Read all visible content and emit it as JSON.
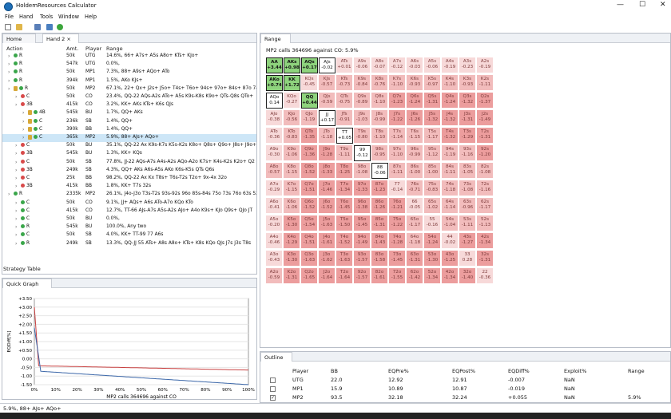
{
  "window": {
    "title": "HoldemResources Calculator"
  },
  "menu": [
    "File",
    "Hand",
    "Tools",
    "Window",
    "Help"
  ],
  "left_tabs": [
    "Home",
    "Hand 2"
  ],
  "columns": [
    "Action",
    "Amt.",
    "Player",
    "Range"
  ],
  "rows": [
    {
      "action": "R",
      "amt": "50k",
      "player": "UTG",
      "range": "14.6%, 66+ A7s+ A5s A8o+ KTs+ KJo+"
    },
    {
      "action": "R",
      "amt": "547k",
      "player": "UTG",
      "range": "0.0%,"
    },
    {
      "action": "R",
      "amt": "50k",
      "player": "MP1",
      "range": "7.3%, 88+ A9s+ AQo+ ATo"
    },
    {
      "action": "R",
      "amt": "394k",
      "player": "MP1",
      "range": "1.5%, AKo KJs+"
    },
    {
      "action": "R",
      "amt": "50k",
      "player": "MP2",
      "range": "67.1%, 22+ Qx+ J2s+ J5o+ T4s+ T6o+ 94s+ 97o+ 84s+ 87o 74s+"
    },
    {
      "action": "C",
      "amt": "50k",
      "player": "CO",
      "range": "23.4%, QQ-22 AQs-A2s ATo+ A5s K9s-K8s K9o+ QTs-Q8s QTo+"
    },
    {
      "action": "3B",
      "amt": "415k",
      "player": "CO",
      "range": "3.2%, KK+ AKs KTs+ K6s QJs"
    },
    {
      "action": "4B",
      "amt": "545k",
      "player": "BU",
      "range": "1.7%, QQ+ AKs"
    },
    {
      "action": "C",
      "amt": "236k",
      "player": "SB",
      "range": "1.4%, QQ+"
    },
    {
      "action": "C",
      "amt": "390k",
      "player": "BB",
      "range": "1.4%, QQ+"
    },
    {
      "action": "C",
      "amt": "365k",
      "player": "MP2",
      "range": "5.9%, 88+ AJs+ AQo+"
    },
    {
      "action": "C",
      "amt": "50k",
      "player": "BU",
      "range": "35.1%, QQ-22 Ax K9s-K7s K5s-K2s K8o+ Q8s+ Q9o+ J8s+ J9o+ T"
    },
    {
      "action": "3B",
      "amt": "545k",
      "player": "BU",
      "range": "1.3%, KK+ KQs"
    },
    {
      "action": "C",
      "amt": "50k",
      "player": "SB",
      "range": "77.8%, JJ-22 AQs-A7s A4s-A2s AQo-A2o K7s+ K4s-K2s K2o+ Q2"
    },
    {
      "action": "3B",
      "amt": "249k",
      "player": "SB",
      "range": "4.3%, QQ+ AKs A6s-A5s AKo K6s-K5s QTs Q6s"
    },
    {
      "action": "C",
      "amt": "25k",
      "player": "BB",
      "range": "98.2%, QQ-22 Ax Kx T8s+ T6s-T2s T2o+ 9x-4x 32o"
    },
    {
      "action": "3B",
      "amt": "415k",
      "player": "BB",
      "range": "1.8%, KK+ T7s 32s"
    },
    {
      "action": "R",
      "amt": "2335k",
      "player": "MP2",
      "range": "26.1%, J4o-J3o T3s-T2s 93s-92s 96o 85s-84s 75o 73s 76o 63s 52s 54o 4"
    },
    {
      "action": "C",
      "amt": "50k",
      "player": "CO",
      "range": "9.1%, JJ+ AQs+ A6s ATo-A7o KQo KTo"
    },
    {
      "action": "C",
      "amt": "415k",
      "player": "CO",
      "range": "12.7%, TT-66 AJs-A7s A5s-A2s AJo+ A4o K9s+ KJo Q9s+ QJo JT"
    },
    {
      "action": "C",
      "amt": "50k",
      "player": "BU",
      "range": "0.0%,"
    },
    {
      "action": "R",
      "amt": "545k",
      "player": "BU",
      "range": "100.0%, Any two"
    },
    {
      "action": "C",
      "amt": "50k",
      "player": "SB",
      "range": "4.0%, KK+ TT-99 77 A6s"
    },
    {
      "action": "R",
      "amt": "249k",
      "player": "SB",
      "range": "13.3%, QQ-JJ 55 ATs+ A8s A8o+ KTs+ K8s KQo QJs J7s J3s T8s"
    }
  ],
  "strategy_table": "Strategy Table",
  "quick_graph": {
    "tab": "Quick Graph",
    "ylabel": "EQDiff[%]",
    "yticks": [
      "+3.50",
      "+3.00",
      "+2.50",
      "+2.00",
      "+1.50",
      "+1.00",
      "+0.50",
      "0.00",
      "-0.50",
      "-1.00",
      "-1.50"
    ],
    "xticks": [
      "0%",
      "10%",
      "20%",
      "30%",
      "40%",
      "50%",
      "60%",
      "70%",
      "80%",
      "90%",
      "100%"
    ],
    "caption": "MP2 calls 364696 against CO"
  },
  "range_panel": {
    "tab": "Range",
    "subtitle": "MP2 calls 364696 against CO: 5.9%",
    "ranks": [
      "A",
      "K",
      "Q",
      "J",
      "T",
      "9",
      "8",
      "7",
      "6",
      "5",
      "4",
      "3",
      "2"
    ],
    "cells": [
      [
        "+3.44",
        "+0.98",
        "+0.17",
        "-0.02",
        "+0.01",
        "-0.06",
        "-0.07",
        "-0.12",
        "-0.03",
        "-0.06",
        "-0.19",
        "-0.23",
        "-0.19"
      ],
      [
        "+0.74",
        "+1.72",
        "-0.45",
        "-0.57",
        "-0.73",
        "-0.84",
        "-0.76",
        "-1.10",
        "-0.93",
        "-0.97",
        "-1.10",
        "-0.93",
        "-1.11"
      ],
      [
        "0.14",
        "-0.27",
        "+0.44",
        "-0.59",
        "-0.75",
        "-0.89",
        "-1.10",
        "-1.23",
        "-1.24",
        "-1.31",
        "-1.24",
        "-1.32",
        "-1.37"
      ],
      [
        "-0.38",
        "-0.56",
        "-1.19",
        "+0.17",
        "-0.91",
        "-1.03",
        "-0.99",
        "-1.22",
        "-1.26",
        "-1.32",
        "-1.32",
        "-1.31",
        "-1.49"
      ],
      [
        "-0.36",
        "-0.83",
        "-1.35",
        "-1.18",
        "+0.05",
        "-0.80",
        "-1.10",
        "-1.14",
        "-1.15",
        "-1.17",
        "-1.32",
        "-1.29",
        "-1.31"
      ],
      [
        "-0.30",
        "-1.06",
        "-1.36",
        "-1.28",
        "-1.11",
        "-0.12",
        "-0.95",
        "-1.10",
        "-0.99",
        "-1.12",
        "-1.19",
        "-1.16",
        "-1.20"
      ],
      [
        "-0.57",
        "-1.15",
        "-1.52",
        "-1.33",
        "-1.25",
        "-1.08",
        "-0.06",
        "-1.11",
        "-1.00",
        "-1.00",
        "-1.11",
        "-1.05",
        "-1.08"
      ],
      [
        "-0.29",
        "-1.15",
        "-1.51",
        "-1.46",
        "-1.34",
        "-1.33",
        "-1.23",
        "-0.14",
        "-0.71",
        "-0.83",
        "-1.18",
        "-1.08",
        "-1.16"
      ],
      [
        "-0.41",
        "-1.06",
        "-1.52",
        "-1.52",
        "-1.45",
        "-1.38",
        "-1.26",
        "-1.21",
        "-0.05",
        "-1.02",
        "-1.14",
        "-0.96",
        "-1.17"
      ],
      [
        "-0.20",
        "-1.30",
        "-1.54",
        "-1.63",
        "-1.50",
        "-1.45",
        "-1.31",
        "-1.22",
        "-1.17",
        "-0.16",
        "-1.04",
        "-1.11",
        "-1.13"
      ],
      [
        "-0.46",
        "-1.29",
        "-1.51",
        "-1.61",
        "-1.52",
        "-1.49",
        "-1.43",
        "-1.28",
        "-1.18",
        "-1.24",
        "-0.02",
        "-1.27",
        "-1.34"
      ],
      [
        "-0.43",
        "-1.30",
        "-1.63",
        "-1.62",
        "-1.63",
        "-1.57",
        "-1.58",
        "-1.45",
        "-1.31",
        "-1.30",
        "-1.25",
        "0.28",
        "-1.31"
      ],
      [
        "-0.59",
        "-1.31",
        "-1.65",
        "-1.64",
        "-1.64",
        "-1.57",
        "-1.61",
        "-1.55",
        "-1.42",
        "-1.34",
        "-1.34",
        "-1.40",
        "-0.36"
      ]
    ]
  },
  "outline": {
    "tab": "Outline",
    "headers": [
      "Player",
      "BB",
      "EQPre%",
      "EQPost%",
      "EQDiff%",
      "Exploit%",
      "Range"
    ],
    "rows": [
      {
        "checked": false,
        "check": "",
        "player": "UTG",
        "bb": "22.0",
        "pre": "12.92",
        "post": "12.91",
        "diff": "-0.007",
        "exploit": "NaN",
        "range": ""
      },
      {
        "checked": false,
        "check": "",
        "player": "MP1",
        "bb": "15.9",
        "pre": "10.89",
        "post": "10.87",
        "diff": "-0.019",
        "exploit": "NaN",
        "range": ""
      },
      {
        "checked": true,
        "check": "✓",
        "player": "MP2",
        "bb": "93.5",
        "pre": "32.18",
        "post": "32.24",
        "diff": "+0.055",
        "exploit": "NaN",
        "range": "5.9%"
      }
    ]
  },
  "status": "5.9%, 88+ AJs+ AQo+"
}
